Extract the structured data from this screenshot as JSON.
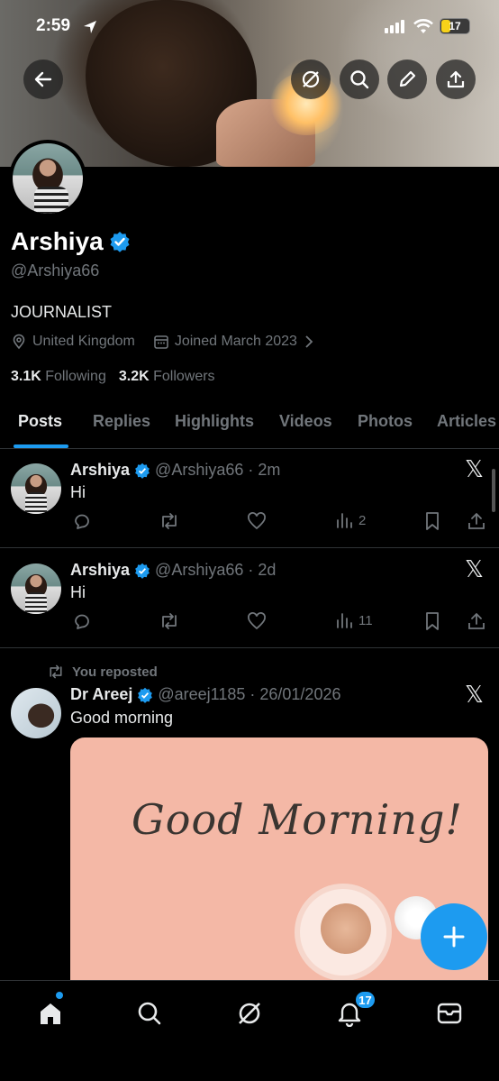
{
  "status_bar": {
    "time": "2:59",
    "battery": "17"
  },
  "profile": {
    "name": "Arshiya",
    "handle": "@Arshiya66",
    "bio": "JOURNALIST",
    "location": "United Kingdom",
    "joined": "Joined March 2023",
    "following_count": "3.1K",
    "following_label": "Following",
    "followers_count": "3.2K",
    "followers_label": "Followers"
  },
  "tabs": [
    "Posts",
    "Replies",
    "Highlights",
    "Videos",
    "Photos",
    "Articles"
  ],
  "posts": [
    {
      "name": "Arshiya",
      "handle": "@Arshiya66",
      "time": "2m",
      "text": "Hi",
      "views": "2"
    },
    {
      "name": "Arshiya",
      "handle": "@Arshiya66",
      "time": "2d",
      "text": "Hi",
      "views": "11"
    }
  ],
  "repost": {
    "label": "You reposted",
    "name": "Dr Areej",
    "handle": "@areej1185",
    "time": "26/01/2026",
    "text": "Good morning",
    "image_text": "Good Morning!"
  },
  "bottom_nav": {
    "notification_count": "17"
  },
  "colors": {
    "accent": "#1d9bf0",
    "muted": "#71767b",
    "background": "#000000"
  }
}
